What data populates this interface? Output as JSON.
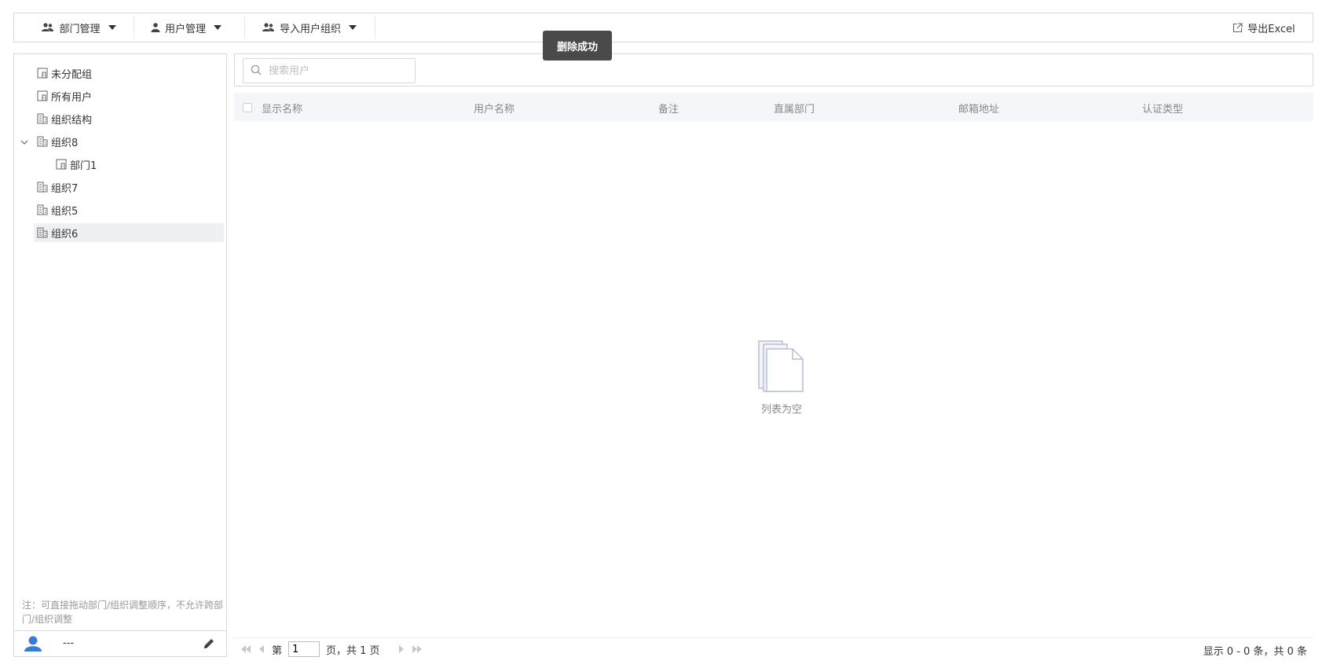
{
  "toolbar": {
    "dept_mgmt": "部门管理",
    "user_mgmt": "用户管理",
    "import_org": "导入用户组织",
    "export": "导出Excel"
  },
  "toast": {
    "message": "删除成功"
  },
  "tree": {
    "items": [
      {
        "label": "未分配组",
        "icon": "dept-icon"
      },
      {
        "label": "所有用户",
        "icon": "dept-icon"
      },
      {
        "label": "组织结构",
        "icon": "building-icon"
      },
      {
        "label": "组织8",
        "icon": "building-icon",
        "expanded": true
      },
      {
        "label": "部门1",
        "icon": "dept-icon"
      },
      {
        "label": "组织7",
        "icon": "building-icon"
      },
      {
        "label": "组织5",
        "icon": "building-icon"
      },
      {
        "label": "组织6",
        "icon": "building-icon",
        "selected": true
      }
    ],
    "note": "注：可直接拖动部门/组织调整顺序，不允许跨部门/组织调整"
  },
  "current_user": {
    "name": "---"
  },
  "search": {
    "placeholder": "搜索用户",
    "value": ""
  },
  "table": {
    "columns": [
      "显示名称",
      "用户名称",
      "备注",
      "直属部门",
      "邮箱地址",
      "认证类型"
    ],
    "empty_text": "列表为空"
  },
  "pager": {
    "prefix": "第",
    "current_page": "1",
    "suffix": "页，共 1 页",
    "summary": "显示 0 - 0 条，共 0 条"
  },
  "colors": {
    "accent": "#3a7bd5",
    "toast_bg": "#4a4a4a",
    "header_bg": "#f5f6fa",
    "selected_bg": "#eef0f4"
  }
}
